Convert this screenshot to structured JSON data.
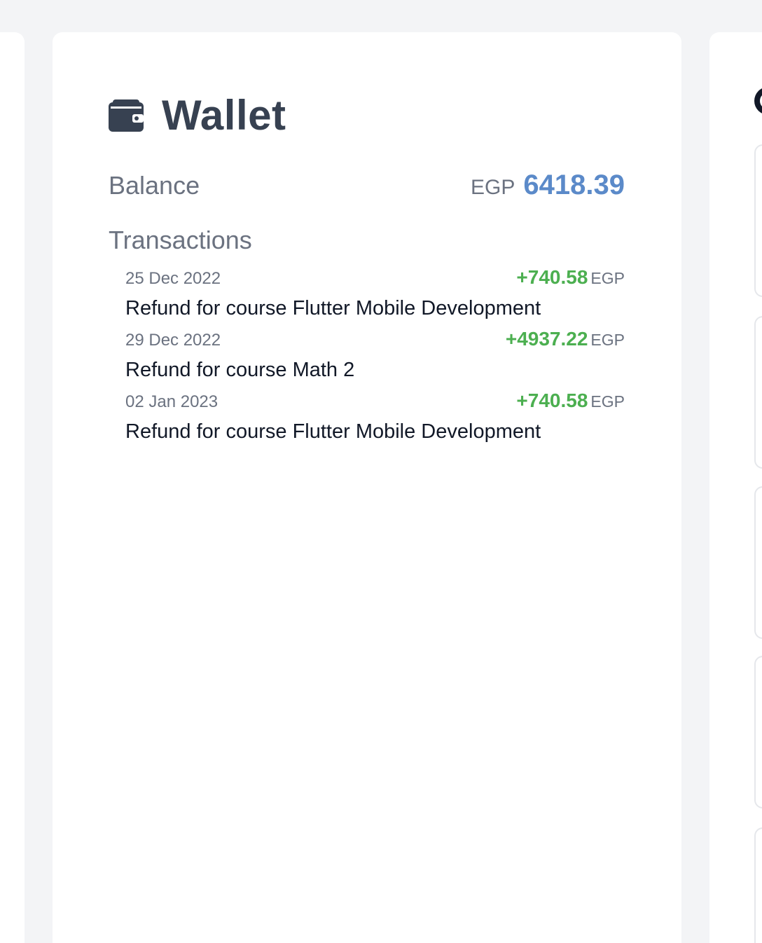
{
  "wallet": {
    "title": "Wallet",
    "icon": "wallet-icon",
    "balance_label": "Balance",
    "balance_currency": "EGP",
    "balance_amount": "6418.39",
    "transactions_label": "Transactions",
    "transactions": [
      {
        "date": "25 Dec 2022",
        "amount": "+740.58",
        "currency": "EGP",
        "description": "Refund for course Flutter Mobile Development"
      },
      {
        "date": "29 Dec 2022",
        "amount": "+4937.22",
        "currency": "EGP",
        "description": "Refund for course Math 2"
      },
      {
        "date": "02 Jan 2023",
        "amount": "+740.58",
        "currency": "EGP",
        "description": "Refund for course Flutter Mobile Development"
      }
    ]
  },
  "colors": {
    "page_background": "#f3f4f6",
    "card_background": "#ffffff",
    "title": "#374151",
    "muted_text": "#6b7280",
    "balance_accent": "#5b8ac9",
    "positive_amount": "#4caf50"
  }
}
